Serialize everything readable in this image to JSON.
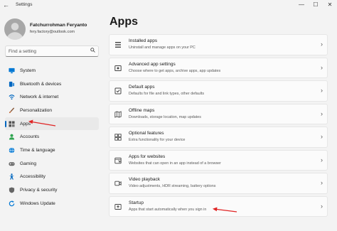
{
  "window": {
    "title": "Settings",
    "back_glyph": "←",
    "minimize_glyph": "—",
    "maximize_glyph": "☐",
    "close_glyph": "✕"
  },
  "profile": {
    "name": "Fatchurrohman Feryanto",
    "email": "fery.factory@outlook.com"
  },
  "search": {
    "placeholder": "Find a setting",
    "icon": "search-icon"
  },
  "sidebar": {
    "items": [
      {
        "label": "System",
        "icon": "monitor-icon",
        "color": "#0078d4"
      },
      {
        "label": "Bluetooth & devices",
        "icon": "bluetooth-icon",
        "color": "#0067c0"
      },
      {
        "label": "Network & internet",
        "icon": "wifi-icon",
        "color": "#0067c0"
      },
      {
        "label": "Personalization",
        "icon": "brush-icon",
        "color": "#c26b3a"
      },
      {
        "label": "Apps",
        "icon": "apps-icon",
        "color": "#555555",
        "active": true
      },
      {
        "label": "Accounts",
        "icon": "person-icon",
        "color": "#2ea44f"
      },
      {
        "label": "Time & language",
        "icon": "globe-icon",
        "color": "#0078d4"
      },
      {
        "label": "Gaming",
        "icon": "gamepad-icon",
        "color": "#666666"
      },
      {
        "label": "Accessibility",
        "icon": "accessibility-icon",
        "color": "#0067c0"
      },
      {
        "label": "Privacy & security",
        "icon": "shield-icon",
        "color": "#666666"
      },
      {
        "label": "Windows Update",
        "icon": "update-icon",
        "color": "#0078d4"
      }
    ]
  },
  "main": {
    "title": "Apps",
    "cards": [
      {
        "title": "Installed apps",
        "desc": "Uninstall and manage apps on your PC",
        "icon": "installed-apps-icon"
      },
      {
        "title": "Advanced app settings",
        "desc": "Choose where to get apps, archive apps, app updates",
        "icon": "advanced-settings-icon"
      },
      {
        "title": "Default apps",
        "desc": "Defaults for file and link types, other defaults",
        "icon": "default-apps-icon"
      },
      {
        "title": "Offline maps",
        "desc": "Downloads, storage location, map updates",
        "icon": "map-icon"
      },
      {
        "title": "Optional features",
        "desc": "Extra functionality for your device",
        "icon": "optional-features-icon"
      },
      {
        "title": "Apps for websites",
        "desc": "Websites that can open in an app instead of a browser",
        "icon": "websites-icon"
      },
      {
        "title": "Video playback",
        "desc": "Video adjustments, HDR streaming, battery options",
        "icon": "video-icon"
      },
      {
        "title": "Startup",
        "desc": "Apps that start automatically when you sign in",
        "icon": "startup-icon"
      }
    ],
    "chevron": "›"
  },
  "colors": {
    "accent": "#0067c0",
    "annotation_arrow": "#e02424"
  }
}
